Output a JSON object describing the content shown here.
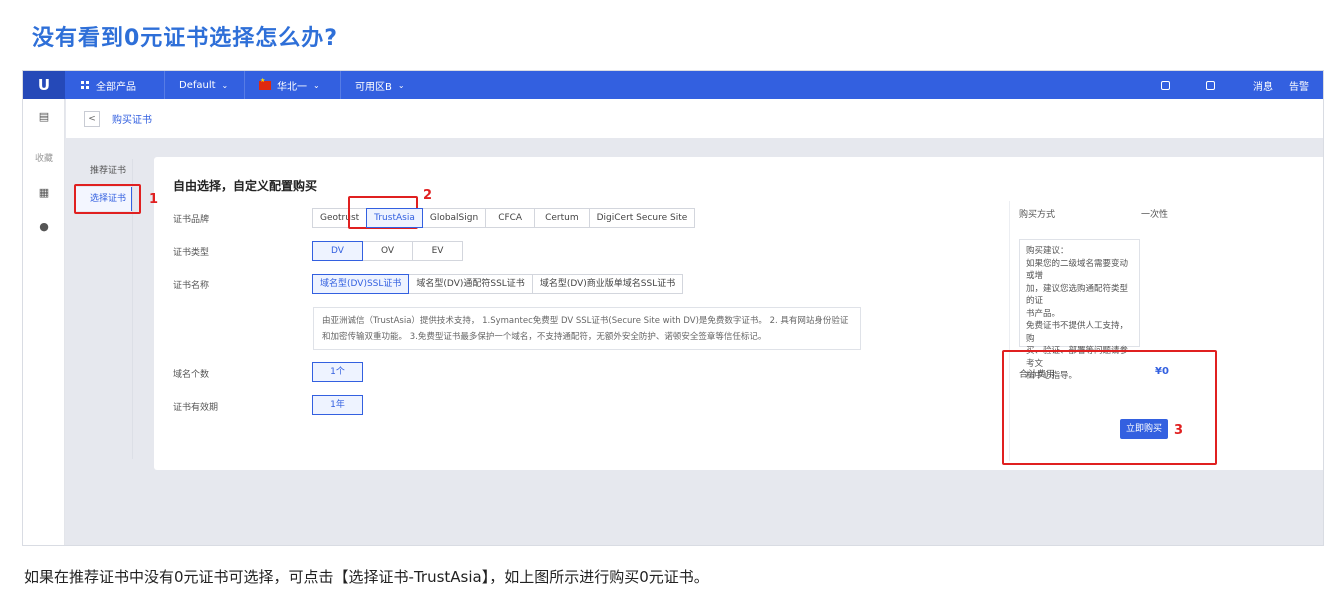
{
  "doc": {
    "title": "没有看到0元证书选择怎么办?",
    "caption": "如果在推荐证书中没有0元证书可选择，可点击【选择证书-TrustAsia】，如上图所示进行购买0元证书。"
  },
  "topbar": {
    "logo": "U",
    "all_products": "全部产品",
    "project": "Default",
    "region": "华北一",
    "zone": "可用区B",
    "messages": "消息",
    "alerts": "告警"
  },
  "rail": {
    "favorites_label": "收藏"
  },
  "breadcrumb": {
    "back": "<",
    "label": "购买证书"
  },
  "subnav": {
    "items": [
      {
        "label": "推荐证书"
      },
      {
        "label": "选择证书"
      }
    ]
  },
  "form": {
    "title": "自由选择，自定义配置购买",
    "brand_label": "证书品牌",
    "brands": [
      "Geotrust",
      "TrustAsia",
      "GlobalSign",
      "CFCA",
      "Certum",
      "DigiCert Secure Site"
    ],
    "selected_brand": "TrustAsia",
    "type_label": "证书类型",
    "types": [
      "DV",
      "OV",
      "EV"
    ],
    "selected_type": "DV",
    "name_label": "证书名称",
    "names": [
      "域名型(DV)SSL证书",
      "域名型(DV)通配符SSL证书",
      "域名型(DV)商业版单域名SSL证书"
    ],
    "selected_name": "域名型(DV)SSL证书",
    "description_line1": "由亚洲诚信（TrustAsia）提供技术支持， 1.Symantec免费型 DV SSL证书(Secure Site with DV)是免费数字证书。 2. 具有网站身份验证",
    "description_line2": "和加密传输双重功能。 3.免费型证书最多保护一个域名，不支持通配符，无额外安全防护、诺顿安全签章等信任标记。",
    "domain_count_label": "域名个数",
    "domain_count_value": "1个",
    "validity_label": "证书有效期",
    "validity_value": "1年"
  },
  "purchase": {
    "method_label": "购买方式",
    "method_value": "一次性",
    "advice_lines": [
      "购买建议：",
      "如果您的二级域名需要变动或增",
      "加，建议您选购通配符类型的证",
      "书产品。",
      "免费证书不提供人工支持，购",
      "买、验证、部署等问题请参考文",
      "档中心指导。"
    ],
    "total_label": "合计费用",
    "total_value": "¥0",
    "buy_button": "立即购买"
  },
  "annotations": {
    "marker1": "1",
    "marker2": "2",
    "marker3": "3",
    "color": "#e02020"
  },
  "colors": {
    "title_blue": "#2e6fd8",
    "topbar_blue": "#3360e0"
  }
}
